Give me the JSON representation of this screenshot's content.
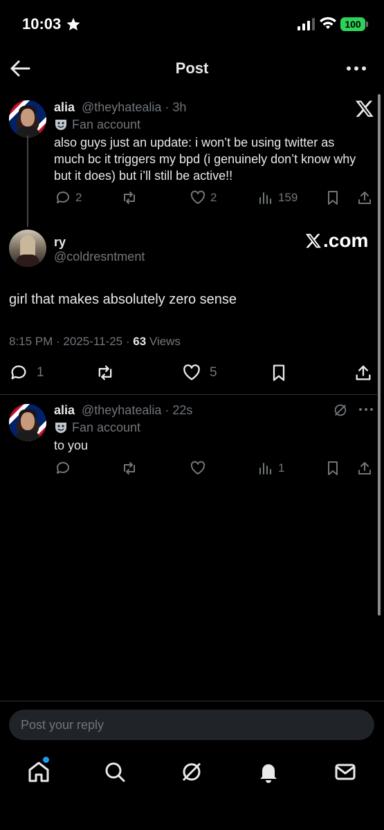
{
  "status_bar": {
    "time": "10:03",
    "battery": "100"
  },
  "header": {
    "title": "Post"
  },
  "quoted_post": {
    "name": "alia",
    "handle": "@theyhatealia · 3h",
    "badge": "Fan account",
    "text": "also guys just an update: i won’t be using twitter as much bc it triggers my bpd (i genuinely don’t know why but it does) but i’ll still be active!!",
    "replies": "2",
    "likes": "2",
    "views": "159"
  },
  "main_post": {
    "name": "ry",
    "handle": "@coldresntment",
    "watermark": ".com",
    "text": "girl that makes absolutely zero sense",
    "timestamp": "8:15 PM · 2025-11-25 · ",
    "views_count": "63",
    "views_label": " Views",
    "replies": "1",
    "likes": "5"
  },
  "reply_post": {
    "name": "alia",
    "handle": "@theyhatealia · 22s",
    "badge": "Fan account",
    "text": "to you",
    "views": "1"
  },
  "reply_bar": {
    "placeholder": "Post your reply"
  },
  "tabs": [
    "home-icon",
    "search-icon",
    "grok-icon",
    "bell-icon",
    "mail-icon"
  ]
}
